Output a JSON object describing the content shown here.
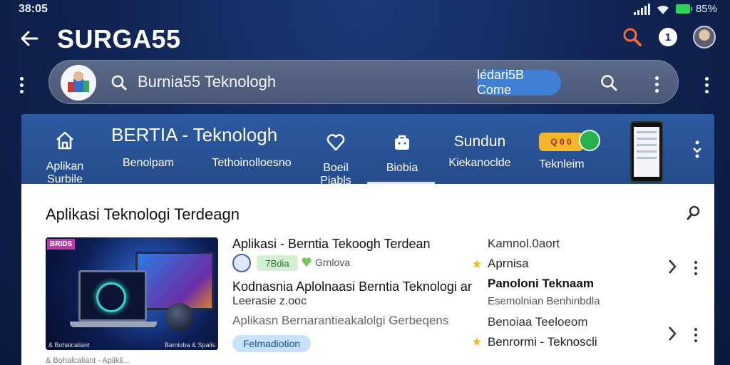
{
  "status_bar": {
    "time": "38:05",
    "battery": "85%"
  },
  "header": {
    "title": "SURGA55",
    "notification_count": "1"
  },
  "search": {
    "query": "Burnia55 Teknologh",
    "chip_label": "lédari5B Come"
  },
  "categories": {
    "banner_title": "BERTIA - Teknologh",
    "items": [
      {
        "label": "Aplikan Surbile",
        "icon": "home-icon"
      },
      {
        "label": "Benolpam"
      },
      {
        "label": "Tethoinolloesno"
      },
      {
        "label": "Boeil Piabls",
        "icon": "heart-icon"
      },
      {
        "label": "Biobia",
        "icon": "bag-icon"
      },
      {
        "label_top": "Sundun",
        "label": "Kiekanoclde"
      },
      {
        "label": "Teknleim",
        "badge_text": "Q 0 0"
      }
    ]
  },
  "section": {
    "title": "Aplikasi Teknologi Terdeagn",
    "thumb_tag": "BRIDS",
    "thumb_caption_left": "& Bohalcaliant",
    "thumb_caption_right": "Bamioba & Spalis",
    "item": {
      "title": "Aplikasi - Berntia Tekoogh Terdean",
      "rating_chip": "7Bdia",
      "meta": "Grnlova",
      "headline_1": "Kodnasnia Aplolnaasi Berntia Teknologi ar",
      "headline_2": "Leerasie z.ooc",
      "description": "Aplikasn Bernarantieakalolgi Gerbeqens",
      "chip": "Felmadiotion"
    },
    "right_column": {
      "line1": "Kamnol.0aort",
      "line2": "Aprnisa",
      "line3": "Panoloni Teknaam",
      "line4": "Esemolnian Benhinbdla",
      "line5": "Benoiaa Teeloeom",
      "line6": "Benrormi - Teknoscli"
    },
    "below_caption": "& Bohalcaliant - Aplikii..."
  },
  "colors": {
    "background": "#0f2250",
    "accent": "#3f7fd4",
    "strip": "#2c5aa0"
  }
}
